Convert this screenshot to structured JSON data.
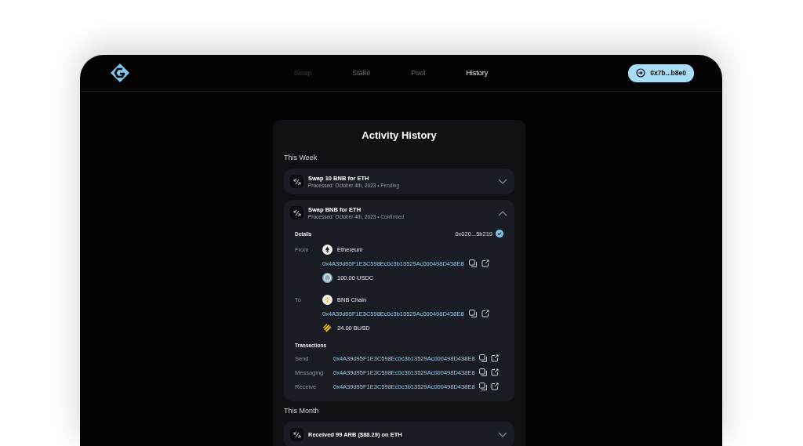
{
  "nav": {
    "tabs": [
      {
        "label": "Swap",
        "selected": false,
        "disabled": true
      },
      {
        "label": "Stake",
        "selected": false,
        "disabled": false
      },
      {
        "label": "Pool",
        "selected": false,
        "disabled": false
      },
      {
        "label": "History",
        "selected": true,
        "disabled": false
      }
    ],
    "wallet": {
      "label": "0x7b...b8e0"
    }
  },
  "card": {
    "title": "Activity History",
    "sections": [
      {
        "heading": "This Week",
        "items": [
          {
            "title": "Swap 10 BNB for ETH",
            "processed": "Processed: October 4th, 2023 •",
            "status": "Pending",
            "expanded": false
          },
          {
            "title": "Swap BNB for ETH",
            "processed": "Processed: October 4th, 2023 •",
            "status": "Confirmed",
            "expanded": true,
            "details": {
              "heading": "Details",
              "hash": "0x020...5b219",
              "verified": true,
              "legs": [
                {
                  "label": "From",
                  "chain": {
                    "name": "Ethereum",
                    "kind": "ethereum"
                  },
                  "address": "0x4A39d95F1E3C598Ec0c3b13529Ac000498D438E8",
                  "token": {
                    "amount": "100.00 USDC",
                    "kind": "usdc"
                  }
                },
                {
                  "label": "To",
                  "chain": {
                    "name": "BNB Chain",
                    "kind": "bnb"
                  },
                  "address": "0x4A39d95F1E3C598Ec0c3b13529Ac000498D438E8",
                  "token": {
                    "amount": "24.00 BUSD",
                    "kind": "busd"
                  }
                }
              ],
              "transactions_heading": "Transactions",
              "transactions": [
                {
                  "label": "Send",
                  "hash": "0x4A39d95F1E3C598Ec0c3b13529Ac000498D438E8"
                },
                {
                  "label": "Messaging",
                  "hash": "0x4A39d95F1E3C598Ec0c3b13529Ac000498D438E8"
                },
                {
                  "label": "Receive",
                  "hash": "0x4A39d95F1E3C598Ec0c3b13529Ac000498D438E8"
                }
              ]
            }
          }
        ]
      },
      {
        "heading": "This Month",
        "items": [
          {
            "title": "Received 99 ARB ($88.29) on ETH",
            "expanded": false
          }
        ]
      }
    ]
  }
}
